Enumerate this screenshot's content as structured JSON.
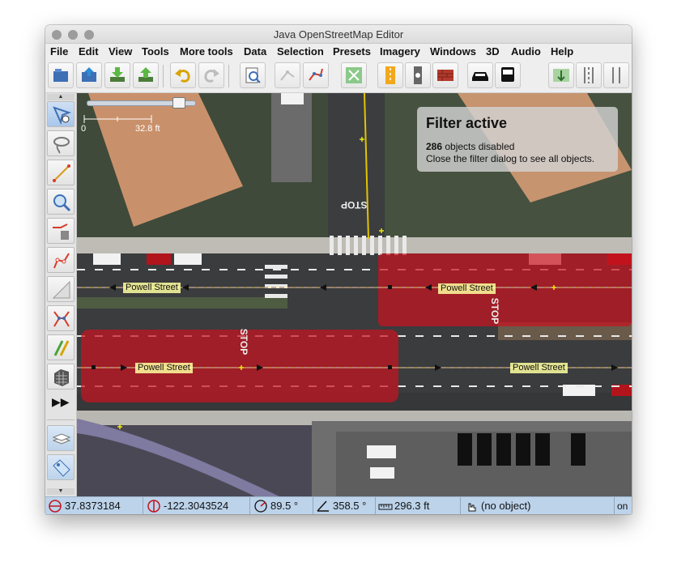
{
  "window": {
    "title": "Java OpenStreetMap Editor"
  },
  "menu": [
    "File",
    "Edit",
    "View",
    "Tools",
    "More tools",
    "Data",
    "Selection",
    "Presets",
    "Imagery",
    "Windows",
    "3D",
    "Audio",
    "Help"
  ],
  "scale": {
    "left": "0",
    "right": "32.8 ft"
  },
  "filter_panel": {
    "heading": "Filter active",
    "count": "286",
    "count_suffix": " objects disabled",
    "hint": "Close the filter dialog to see all objects."
  },
  "streets": [
    "Powell Street",
    "Powell Street",
    "Powell Street",
    "Powell Street"
  ],
  "map_text": {
    "stop1": "STOP",
    "stop2": "STOP",
    "stop3": "STOP"
  },
  "status": {
    "latitude": "37.8373184",
    "longitude": "-122.3043524",
    "heading": "89.5 °",
    "angle": "358.5 °",
    "distance": "296.3 ft",
    "selection": "(no object)",
    "overflow": "on"
  },
  "colors": {
    "highlight": "#c8141e",
    "statusbar": "#bcd3ea",
    "way": "#7a2bbd"
  }
}
